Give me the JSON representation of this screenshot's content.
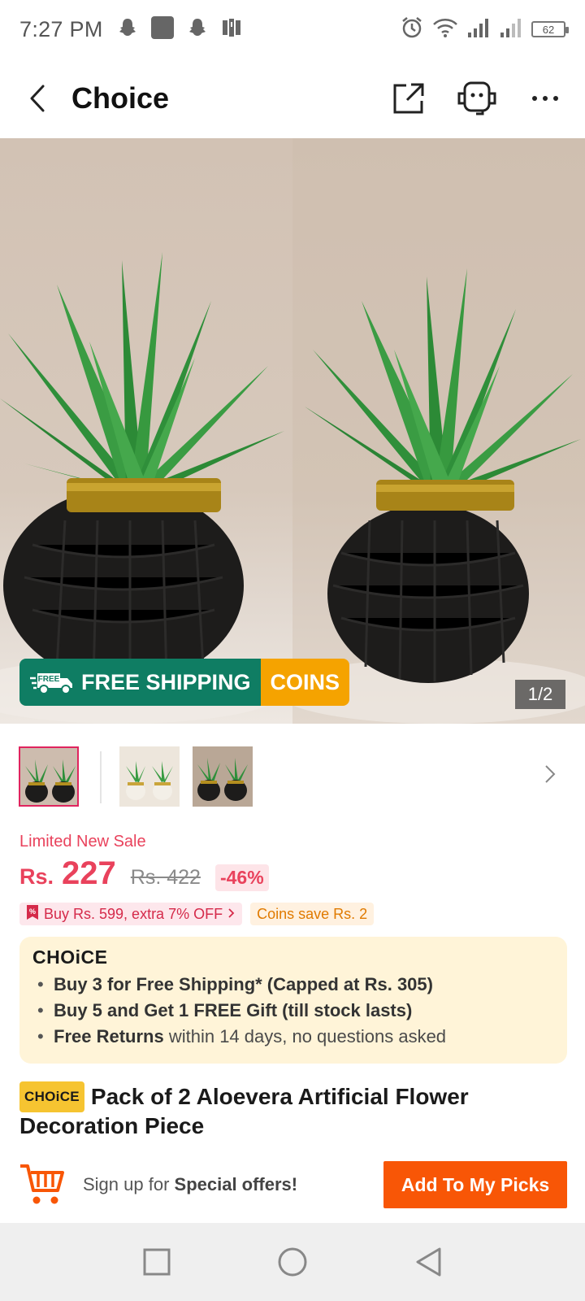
{
  "status_bar": {
    "time": "7:27 PM",
    "battery": "62",
    "left_icons": [
      "snapchat-icon",
      "app-square-icon",
      "snapchat-icon",
      "parking-icon"
    ],
    "right_icons": [
      "alarm-icon",
      "wifi-icon",
      "signal-icon",
      "signal-icon",
      "battery-icon"
    ]
  },
  "header": {
    "title": "Choice",
    "icons": [
      "back-arrow-icon",
      "share-icon",
      "customer-service-icon",
      "more-icon"
    ]
  },
  "hero": {
    "badge_free_small": "FREE",
    "badge_shipping": "FREE SHIPPING",
    "badge_coins": "COINS",
    "counter": "1/2"
  },
  "thumbnails": {
    "count": 3,
    "selected_index": 0
  },
  "price": {
    "sale_label": "Limited New Sale",
    "currency": "Rs.",
    "amount": "227",
    "original": "Rs. 422",
    "discount": "-46%"
  },
  "promos": {
    "buy_more": "Buy Rs. 599, extra 7% OFF",
    "coins_save": "Coins save Rs. 2"
  },
  "choice_card": {
    "logo": "CHOiCE",
    "line1_bold": "Buy 3 for  Free Shipping* (Capped at Rs. 305)",
    "line2_bold": "Buy 5 and Get 1 FREE Gift (till stock lasts)",
    "line3_bold": "Free Returns",
    "line3_rest": " within 14 days, no questions asked"
  },
  "product": {
    "tag": "CHOiCE",
    "title": "Pack of 2 Aloevera Artificial Flower Decoration Piece"
  },
  "action_bar": {
    "signup_prefix": "Sign up for ",
    "signup_bold": "Special offers!",
    "add_button": "Add To My Picks"
  },
  "colors": {
    "accent": "#f85606",
    "sale": "#e9425c",
    "free_shipping": "#0f7d63",
    "coins": "#f5a300",
    "choice_card_bg": "#fff4d8"
  }
}
